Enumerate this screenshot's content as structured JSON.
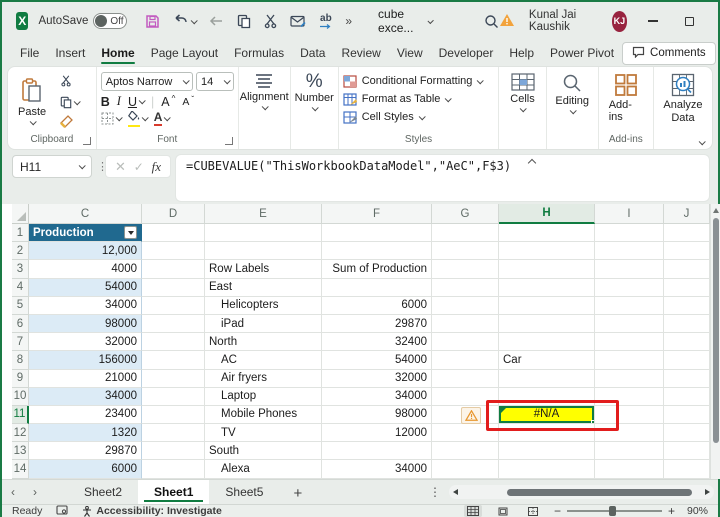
{
  "titlebar": {
    "autosave_label": "AutoSave",
    "autosave_state": "Off",
    "doc_name": "cube exce...",
    "user_name": "Kunal Jai Kaushik",
    "user_initials": "KJ"
  },
  "ribbon": {
    "tabs": [
      {
        "label": "File",
        "active": false
      },
      {
        "label": "Insert",
        "active": false
      },
      {
        "label": "Home",
        "active": true
      },
      {
        "label": "Page Layout",
        "active": false
      },
      {
        "label": "Formulas",
        "active": false
      },
      {
        "label": "Data",
        "active": false
      },
      {
        "label": "Review",
        "active": false
      },
      {
        "label": "View",
        "active": false
      },
      {
        "label": "Developer",
        "active": false
      },
      {
        "label": "Help",
        "active": false
      },
      {
        "label": "Power Pivot",
        "active": false
      }
    ],
    "comments_label": "Comments",
    "clipboard": {
      "paste_label": "Paste",
      "group_label": "Clipboard"
    },
    "font": {
      "name": "Aptos Narrow",
      "size": "14",
      "bold": "B",
      "italic": "I",
      "underline": "U",
      "group_label": "Font"
    },
    "alignment": {
      "label": "Alignment"
    },
    "number": {
      "label": "Number",
      "percent": "%"
    },
    "styles": {
      "conditional_formatting": "Conditional Formatting",
      "format_as_table": "Format as Table",
      "cell_styles": "Cell Styles",
      "group_label": "Styles"
    },
    "cells": {
      "label": "Cells"
    },
    "editing": {
      "label": "Editing"
    },
    "addins": {
      "button_label": "Add-ins",
      "group_label": "Add-ins"
    },
    "analyze": {
      "label": "Analyze Data"
    }
  },
  "formula_bar": {
    "name_box": "H11",
    "fx_label": "fx",
    "cancel": "✕",
    "enter": "✓",
    "formula": "=CUBEVALUE(\"ThisWorkbookDataModel\",\"AeC\",F$3)"
  },
  "grid": {
    "columns": [
      "C",
      "D",
      "E",
      "F",
      "G",
      "H",
      "I",
      "J"
    ],
    "selected_column": "H",
    "selected_row": "11",
    "rows": [
      {
        "n": "1",
        "C": "Production",
        "C_is_table_header": true
      },
      {
        "n": "2",
        "C": "12,000"
      },
      {
        "n": "3",
        "C": "4000",
        "E": "Row Labels",
        "F": "Sum of Production"
      },
      {
        "n": "4",
        "C": "54000",
        "E": "East"
      },
      {
        "n": "5",
        "C": "34000",
        "E": "Helicopters",
        "E_indent": true,
        "F": "6000"
      },
      {
        "n": "6",
        "C": "98000",
        "E": "iPad",
        "E_indent": true,
        "F": "29870"
      },
      {
        "n": "7",
        "C": "32000",
        "E": "North",
        "F": "32400"
      },
      {
        "n": "8",
        "C": "156000",
        "E": "AC",
        "E_indent": true,
        "F": "54000",
        "H": "Car"
      },
      {
        "n": "9",
        "C": "21000",
        "E": "Air fryers",
        "E_indent": true,
        "F": "32000"
      },
      {
        "n": "10",
        "C": "34000",
        "E": "Laptop",
        "E_indent": true,
        "F": "34000"
      },
      {
        "n": "11",
        "C": "23400",
        "E": "Mobile Phones",
        "E_indent": true,
        "F": "98000",
        "H": "#N/A",
        "H_error": true
      },
      {
        "n": "12",
        "C": "1320",
        "E": "TV",
        "E_indent": true,
        "F": "12000"
      },
      {
        "n": "13",
        "C": "29870",
        "E": "South"
      },
      {
        "n": "14",
        "C": "6000",
        "E": "Alexa",
        "E_indent": true,
        "F": "34000"
      }
    ],
    "error_cell": {
      "address": "H11",
      "value": "#N/A",
      "fill_color": "#FFFF00",
      "annotation_color": "#E21D1D"
    }
  },
  "sheet_tabs": {
    "tabs": [
      {
        "label": "Sheet2",
        "active": false
      },
      {
        "label": "Sheet1",
        "active": true
      },
      {
        "label": "Sheet5",
        "active": false
      }
    ],
    "add_label": "+"
  },
  "status_bar": {
    "ready_label": "Ready",
    "accessibility_label": "Accessibility: Investigate",
    "zoom_level": "90%"
  },
  "colors": {
    "accent_green": "#107C41",
    "table_header_blue": "#20698F",
    "band_blue": "#DCEBF6",
    "error_fill_yellow": "#FFFF00",
    "annotation_red": "#E21D1D",
    "avatar_maroon": "#98233F",
    "warning_orange": "#E8A23C",
    "save_icon_pink": "#C25BC0"
  },
  "icons": {
    "excel-logo": "green square X",
    "save-icon": "floppy disk",
    "undo-icon": "curved arrow",
    "back-icon": "left arrow",
    "copy-icon": "two pages",
    "cut-icon": "scissors",
    "mail-icon": "envelope",
    "replace-icon": "ab with arrow",
    "overflow-icon": "»",
    "search-icon": "magnifier",
    "warning-icon": "orange triangle !",
    "comment-icon": "speech bubble",
    "share-icon": "share arrow",
    "paste-icon": "clipboard",
    "format-painter-icon": "brush",
    "borders-icon": "dashed grid",
    "fill-color-icon": "bucket yellow",
    "font-color-icon": "A red",
    "alignment-icon": "text lines",
    "conditional-formatting-icon": "colored grid",
    "format-as-table-icon": "table pencil",
    "cell-styles-icon": "table brush",
    "cells-icon": "table",
    "editing-icon": "magnifier",
    "addins-icon": "orange squares",
    "analyze-data-icon": "chart magnifier",
    "fx-icon": "fx",
    "accessibility-icon": "person",
    "macro-icon": "record square",
    "normal-view-icon": "grid",
    "page-layout-view-icon": "page",
    "page-break-view-icon": "page margins"
  }
}
